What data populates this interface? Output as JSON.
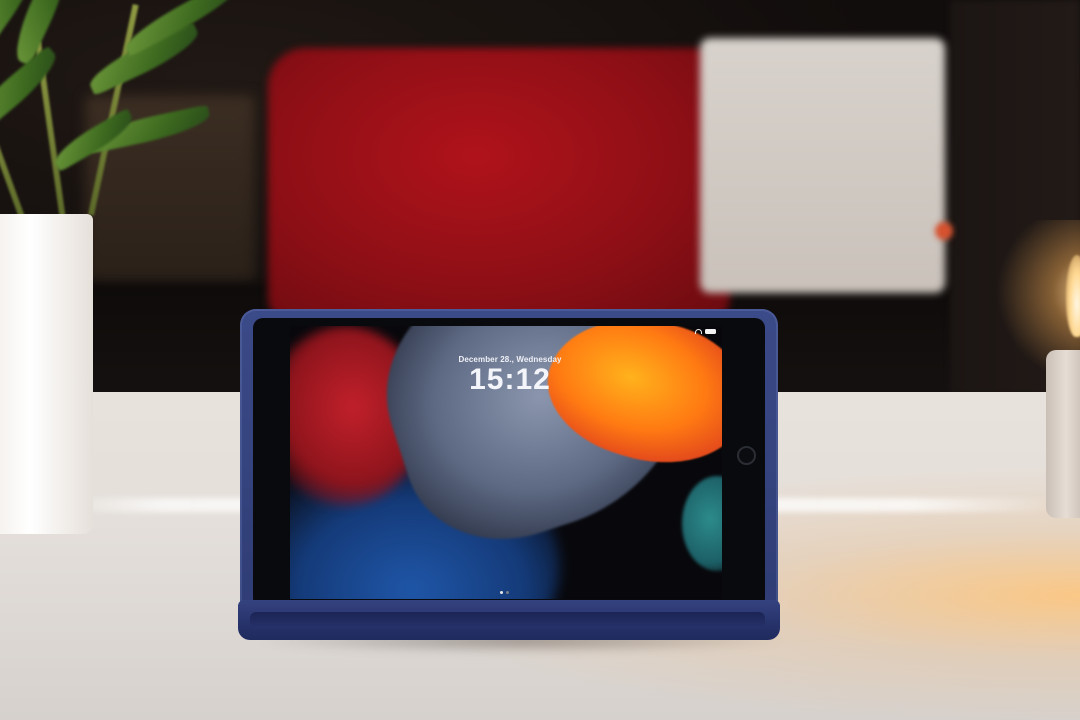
{
  "scene": {
    "description_tags": [
      "tablet-on-stand",
      "lock-screen"
    ]
  },
  "lock_screen": {
    "date": "December 28., Wednesday",
    "time": "15:12"
  },
  "colors": {
    "case": "#2e3b73",
    "chair": "#8f0f16",
    "table": "#e6e1dc",
    "wallpaper_orange": "#ff7a12",
    "wallpaper_grey": "#6b7690",
    "wallpaper_blue": "#1f56a8"
  },
  "icons": [
    "wifi-icon",
    "battery-icon",
    "home-button",
    "camera"
  ]
}
